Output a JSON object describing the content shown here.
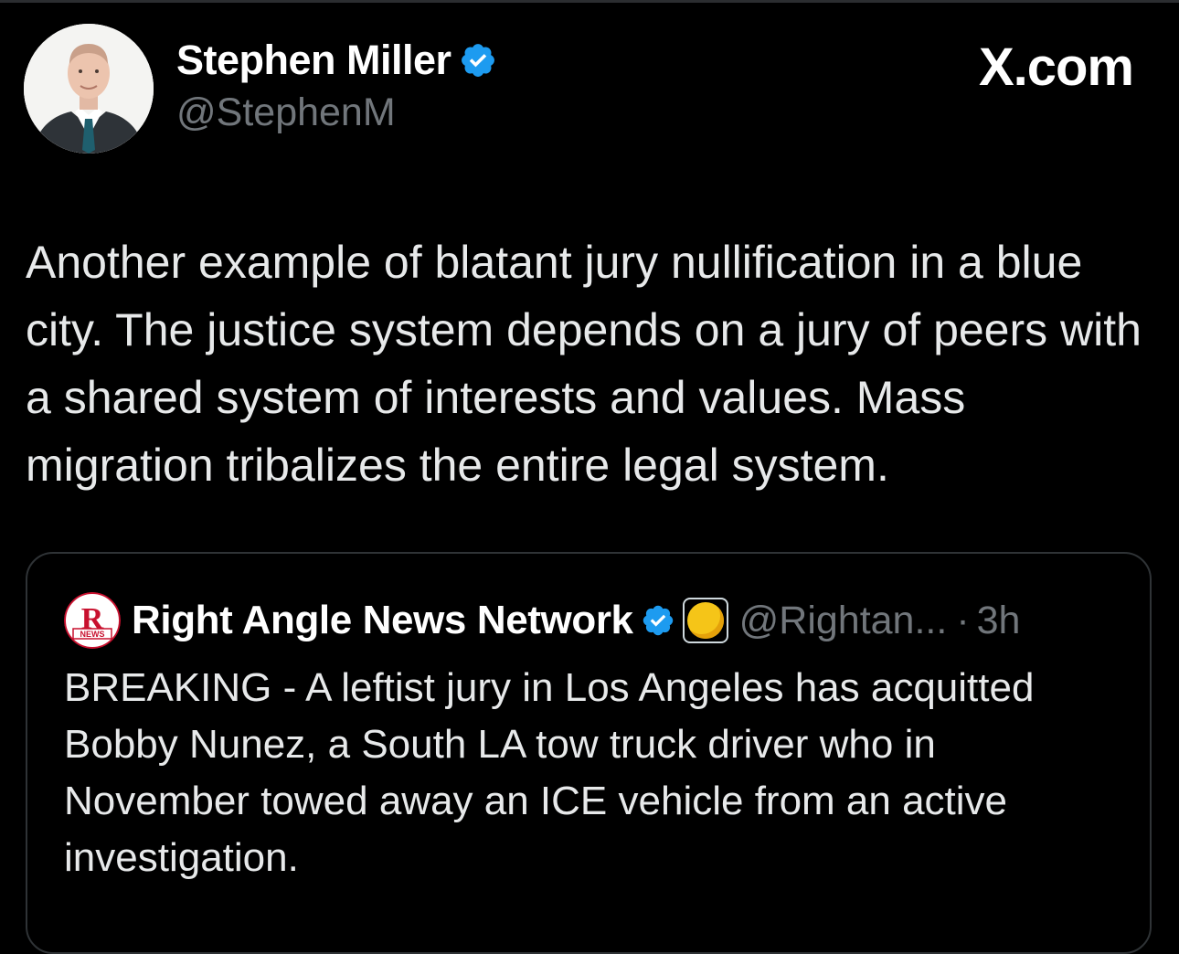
{
  "author": {
    "display_name": "Stephen Miller",
    "handle": "@StephenM",
    "verified_icon": "verified-badge-icon",
    "avatar_icon": "profile-photo"
  },
  "brand": "X.com",
  "tweet": {
    "text": "Another example of blatant jury nullification in a blue city. The justice system depends on a jury of peers with a shared system of interests and values. Mass migration tribalizes the entire legal system."
  },
  "quoted_tweet": {
    "display_name": "Right Angle News Network",
    "handle": "@Rightan...",
    "separator": "·",
    "time": "3h",
    "text": "BREAKING - A leftist jury in Los Angeles has acquitted Bobby Nunez, a South LA tow truck driver who in November towed away an ICE vehicle from an active investigation.",
    "logo": {
      "letter": "R",
      "caption": "NEWS"
    }
  },
  "colors": {
    "background": "#000000",
    "text": "#e7e9ea",
    "muted": "#71767b",
    "verified_blue": "#1d9bf0",
    "card_border": "#2f3336",
    "logo_red": "#c8102e"
  }
}
